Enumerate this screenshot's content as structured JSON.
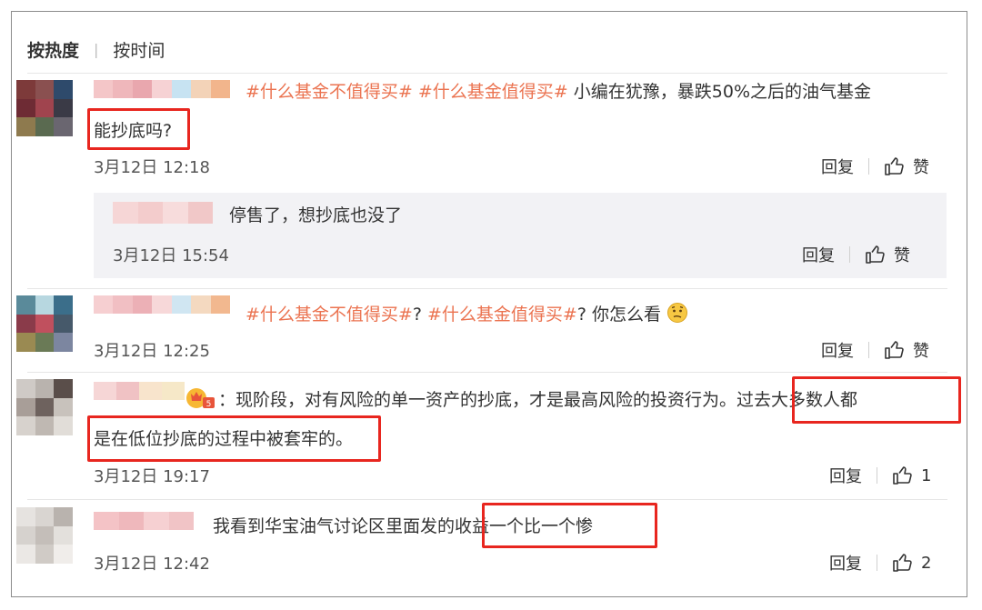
{
  "tabs": {
    "hot": "按热度",
    "time": "按时间"
  },
  "actions": {
    "reply": "回复",
    "like": "赞"
  },
  "colors": {
    "tag": "#eb7350",
    "highlight": "#e8261f",
    "reply_bg": "#f2f2f5"
  },
  "comments": [
    {
      "tag1": "#什么基金不值得买#",
      "tag2": "#什么基金值得买#",
      "line1": " 小编在犹豫，暴跌50%之后的油气基金",
      "line2": "能抄底吗?",
      "time": "3月12日 12:18",
      "like": "赞",
      "reply": {
        "text": "停售了，想抄底也没了",
        "time": "3月12日 15:54",
        "like": "赞"
      }
    },
    {
      "tag1": "#什么基金不值得买#",
      "sep": "?",
      "tag2": "#什么基金值得买#",
      "tail": "? 你怎么看",
      "emoji": "thinking-face-icon",
      "time": "3月12日 12:25",
      "like": "赞"
    },
    {
      "icon": "fan-badge-icon",
      "line1a": "：现阶段，对有风险的单一资产的抄底，才是最高风险的投资行为。",
      "line1b": "过去大多数人都",
      "line2": "是在低位抄底的过程中被套牢的。",
      "time": "3月12日 19:17",
      "like": "1"
    },
    {
      "text_a": "我看到华宝油气讨论区里面发的",
      "text_b": "收益一个比一个惨",
      "time": "3月12日 12:42",
      "like": "2"
    }
  ]
}
